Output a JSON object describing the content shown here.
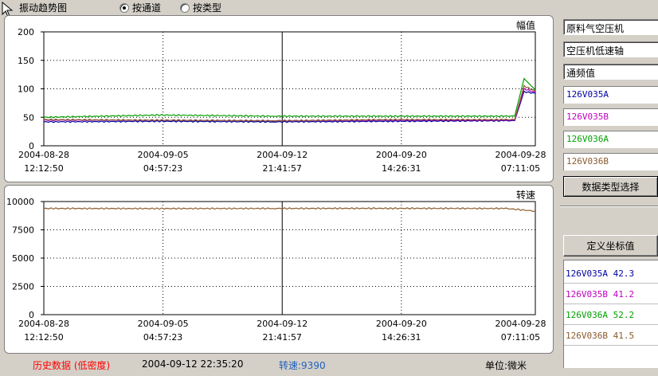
{
  "header": {
    "title": "振动趋势图",
    "radio_options": [
      {
        "label": "按通道",
        "selected": true
      },
      {
        "label": "按类型",
        "selected": false
      }
    ]
  },
  "top_chart": {
    "unit_label": "幅值",
    "y_ticks": [
      "200",
      "150",
      "100",
      "50",
      "0"
    ],
    "x_labels": [
      {
        "date": "2004-08-28",
        "time": "12:12:50"
      },
      {
        "date": "2004-09-05",
        "time": "04:57:23"
      },
      {
        "date": "2004-09-12",
        "time": "21:41:57"
      },
      {
        "date": "2004-09-20",
        "time": "14:26:31"
      },
      {
        "date": "2004-09-28",
        "time": "07:11:05"
      }
    ]
  },
  "bottom_chart": {
    "unit_label": "转速",
    "y_ticks": [
      "10000",
      "7500",
      "5000",
      "2500",
      "0"
    ],
    "x_labels": [
      {
        "date": "2004-08-28",
        "time": "12:12:50"
      },
      {
        "date": "2004-09-05",
        "time": "04:57:23"
      },
      {
        "date": "2004-09-12",
        "time": "21:41:57"
      },
      {
        "date": "2004-09-20",
        "time": "14:26:31"
      },
      {
        "date": "2004-09-28",
        "time": "07:11:05"
      }
    ]
  },
  "sidebar": {
    "device": "原料气空压机",
    "component": "空压机低速轴",
    "measure": "通频值",
    "channels": [
      {
        "name": "126V035A",
        "color": "#0000a0"
      },
      {
        "name": "126V035B",
        "color": "#c000c0"
      },
      {
        "name": "126V036A",
        "color": "#00a000"
      },
      {
        "name": "126V036B",
        "color": "#8b5a2b"
      }
    ],
    "data_type_button": "数据类型选择",
    "define_axis_button": "定义坐标值",
    "values": [
      {
        "text": "126V035A 42.3",
        "color": "#0000a0"
      },
      {
        "text": "126V035B 41.2",
        "color": "#c000c0"
      },
      {
        "text": "126V036A 52.2",
        "color": "#00a000"
      },
      {
        "text": "126V036B 41.5",
        "color": "#8b5a2b"
      }
    ]
  },
  "status": {
    "mode": "历史数据 (低密度)",
    "mode_color": "#ff0000",
    "timestamp": "2004-09-12 22:35:20",
    "speed": "转速:9390",
    "speed_color": "#2060c0",
    "unit": "单位:微米"
  },
  "chart_data": [
    {
      "type": "line",
      "title": "",
      "ylabel": "幅值",
      "ylim": [
        0,
        200
      ],
      "x": [
        "2004-08-28 12:12:50",
        "2004-09-05 04:57:23",
        "2004-09-12 21:41:57",
        "2004-09-20 14:26:31",
        "2004-09-28 07:11:05",
        "2004-09-28 21:00:00",
        "2004-09-29 12:00:00",
        "2004-09-30 06:00:00"
      ],
      "series": [
        {
          "name": "126V035A",
          "values": [
            42,
            43,
            42,
            43,
            44,
            44,
            95,
            92
          ]
        },
        {
          "name": "126V035B",
          "values": [
            45,
            45,
            44,
            45,
            45,
            45,
            100,
            94
          ]
        },
        {
          "name": "126V036A",
          "values": [
            50,
            54,
            52,
            52,
            52,
            52,
            118,
            98
          ]
        },
        {
          "name": "126V036B",
          "values": [
            46,
            45,
            44,
            46,
            46,
            46,
            105,
            96
          ]
        }
      ],
      "grid": true
    },
    {
      "type": "line",
      "title": "",
      "ylabel": "转速",
      "ylim": [
        0,
        10000
      ],
      "x": [
        "2004-08-28 12:12:50",
        "2004-09-05 04:57:23",
        "2004-09-12 21:41:57",
        "2004-09-20 14:26:31",
        "2004-09-28 07:11:05",
        "2004-09-30 06:00:00"
      ],
      "series": [
        {
          "name": "126V036B",
          "values": [
            9390,
            9380,
            9390,
            9400,
            9390,
            9150
          ]
        }
      ],
      "grid": true
    }
  ]
}
